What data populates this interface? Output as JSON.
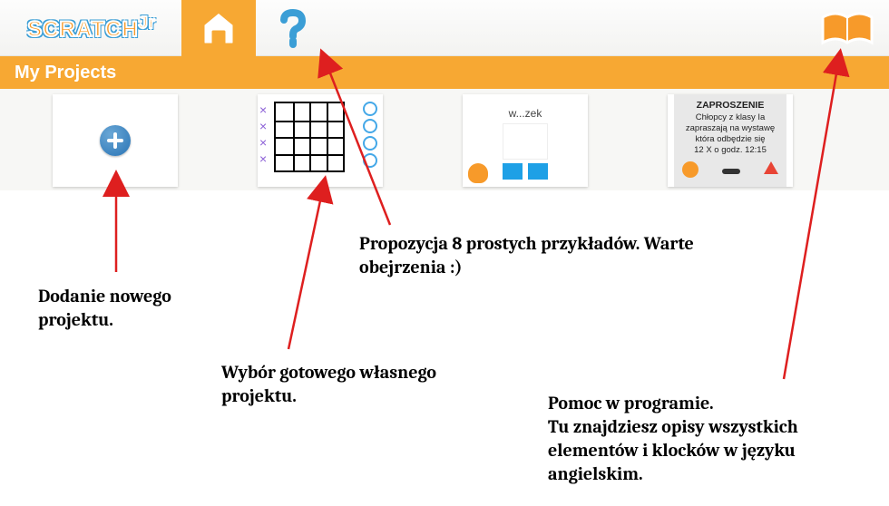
{
  "header": {
    "logo_main": "SCRATCH",
    "logo_suffix": "Jr"
  },
  "titlebar": {
    "label": "My Projects"
  },
  "projects": {
    "wzek_title": "w...zek",
    "invite": {
      "title": "ZAPROSZENIE",
      "line1": "Chłopcy z klasy Ia",
      "line2": "zapraszają na wystawę",
      "line3": "która odbędzie się",
      "line4": "12 X o godz. 12:15"
    }
  },
  "annotations": {
    "new_project": "Dodanie nowego projektu.",
    "choose_project": "Wybór gotowego własnego projektu.",
    "examples": "Propozycja 8 prostych przykładów. Warte obejrzenia :)",
    "help": "Pomoc w programie.\nTu znajdziesz opisy wszystkich elementów i klocków w języku angielskim."
  },
  "colors": {
    "accent": "#f7a833",
    "arrow": "#de1f1f"
  }
}
